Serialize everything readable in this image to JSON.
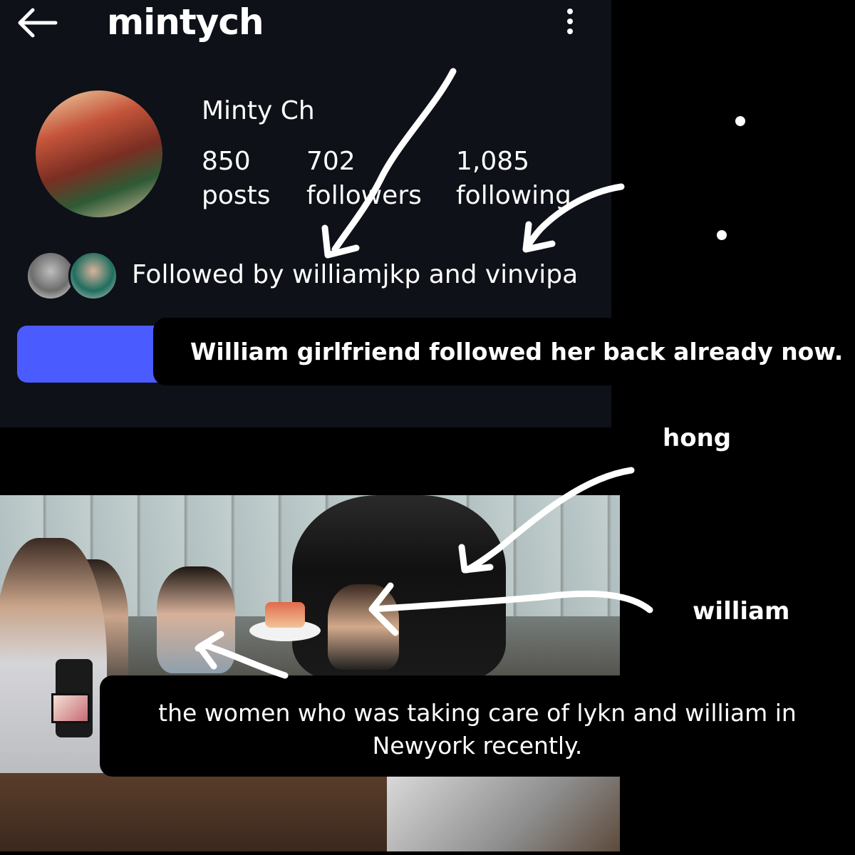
{
  "header": {
    "username": "mintych",
    "back_icon": "arrow-left-icon",
    "more_icon": "more-vertical-icon"
  },
  "profile": {
    "display_name": "Minty Ch",
    "stats": [
      {
        "value": "850",
        "label": "posts"
      },
      {
        "value": "702",
        "label": "followers"
      },
      {
        "value": "1,085",
        "label": "following"
      }
    ],
    "followed_by": "Followed by williamjkp and vinvipa",
    "follow_button_color": "#4a5cff"
  },
  "annotations": {
    "caption_1": "William girlfriend followed her back already now.",
    "label_hong": "hong",
    "label_william": "william",
    "caption_2_line1": "the women who was taking care of lykn and william in",
    "caption_2_line2": "Newyork recently."
  }
}
